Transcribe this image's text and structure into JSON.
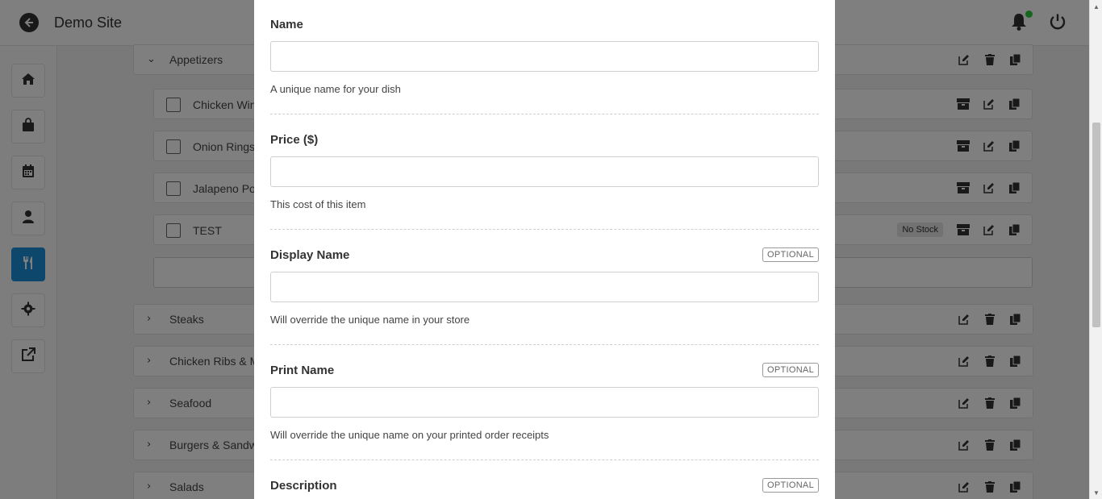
{
  "header": {
    "title": "Demo Site"
  },
  "sidebar": {
    "items": [
      {
        "icon": "home-icon"
      },
      {
        "icon": "shopping-bag-icon"
      },
      {
        "icon": "calendar-icon"
      },
      {
        "icon": "user-icon"
      },
      {
        "icon": "utensils-icon",
        "active": true
      },
      {
        "icon": "gear-icon"
      },
      {
        "icon": "external-link-icon"
      }
    ]
  },
  "menu": {
    "categories": [
      {
        "label": "Appetizers",
        "expanded": true
      },
      {
        "label": "Steaks",
        "expanded": false
      },
      {
        "label": "Chicken Ribs & M",
        "expanded": false
      },
      {
        "label": "Seafood",
        "expanded": false
      },
      {
        "label": "Burgers & Sandw",
        "expanded": false
      },
      {
        "label": "Salads",
        "expanded": false
      }
    ],
    "items": [
      {
        "label": "Chicken Win"
      },
      {
        "label": "Onion Rings"
      },
      {
        "label": "Jalapeno Pop"
      },
      {
        "label": "TEST",
        "badge": "No Stock"
      }
    ]
  },
  "modal": {
    "fields": [
      {
        "label": "Name",
        "value": "",
        "help": "A unique name for your dish"
      },
      {
        "label": "Price ($)",
        "value": "",
        "help": "This cost of this item"
      },
      {
        "label": "Display Name",
        "optional": "OPTIONAL",
        "value": "",
        "help": "Will override the unique name in your store"
      },
      {
        "label": "Print Name",
        "optional": "OPTIONAL",
        "value": "",
        "help": "Will override the unique name on your printed order receipts"
      },
      {
        "label": "Description",
        "optional": "OPTIONAL"
      }
    ]
  },
  "colors": {
    "accent": "#1b8fd6",
    "notification_dot": "#2ecc40"
  }
}
